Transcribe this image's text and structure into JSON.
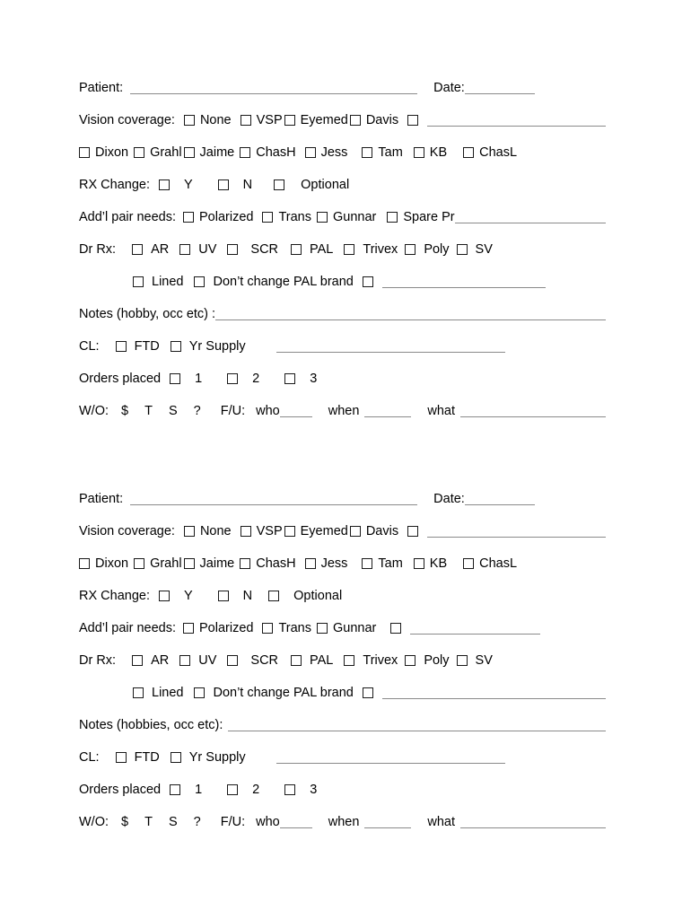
{
  "document": {
    "type": "optical-intake-form",
    "copies": 2,
    "ink_color": "#000000",
    "rule_color": "#8a8a8a"
  },
  "form1": {
    "patient": {
      "label": "Patient:"
    },
    "date": {
      "label": "Date:"
    },
    "vision_coverage": {
      "label": "Vision coverage:",
      "options": [
        "None",
        "VSP",
        "Eyemed",
        "Davis"
      ],
      "other_label": ""
    },
    "providers": [
      "Dixon",
      "Grahl",
      "Jaime",
      "ChasH",
      "Jess",
      "Tam",
      "KB",
      "ChasL"
    ],
    "rx_change": {
      "label": "RX Change:",
      "options": [
        "Y",
        "N",
        "Optional"
      ]
    },
    "addl_pair": {
      "label": "Add’l pair needs:",
      "options": [
        "Polarized",
        "Trans",
        "Gunnar"
      ],
      "spare_label": "Spare Pr"
    },
    "dr_rx": {
      "label": "Dr Rx:",
      "options": [
        "AR",
        "UV",
        "SCR",
        "PAL",
        "Trivex",
        "Poly",
        "SV"
      ]
    },
    "pal_row": {
      "lined": "Lined",
      "dont_change": "Don’t change PAL brand"
    },
    "notes": {
      "label": "Notes (hobby, occ etc) :"
    },
    "cl": {
      "label": "CL:",
      "options": [
        "FTD",
        "Yr Supply"
      ]
    },
    "orders_placed": {
      "label": "Orders placed",
      "options": [
        "1",
        "2",
        "3"
      ]
    },
    "wo": {
      "label": "W/O:",
      "marks": [
        "$",
        "T",
        "S",
        "?"
      ],
      "fu_label": "F/U:",
      "who": "who",
      "when": "when",
      "what": "what"
    }
  },
  "form2": {
    "patient": {
      "label": "Patient:"
    },
    "date": {
      "label": "Date:"
    },
    "vision_coverage": {
      "label": "Vision coverage:",
      "options": [
        "None",
        "VSP",
        "Eyemed",
        "Davis"
      ],
      "other_label": ""
    },
    "providers": [
      "Dixon",
      "Grahl",
      "Jaime",
      "ChasH",
      "Jess",
      "Tam",
      "KB",
      "ChasL"
    ],
    "rx_change": {
      "label": "RX Change:",
      "options": [
        "Y",
        "N",
        "Optional"
      ]
    },
    "addl_pair": {
      "label": "Add’l pair needs:",
      "options": [
        "Polarized",
        "Trans",
        "Gunnar"
      ],
      "spare_label": ""
    },
    "dr_rx": {
      "label": "Dr Rx:",
      "options": [
        "AR",
        "UV",
        "SCR",
        "PAL",
        "Trivex",
        "Poly",
        "SV"
      ]
    },
    "pal_row": {
      "lined": "Lined",
      "dont_change": "Don’t change PAL brand"
    },
    "notes": {
      "label": "Notes (hobbies, occ etc):"
    },
    "cl": {
      "label": "CL:",
      "options": [
        "FTD",
        "Yr Supply"
      ]
    },
    "orders_placed": {
      "label": "Orders placed",
      "options": [
        "1",
        "2",
        "3"
      ]
    },
    "wo": {
      "label": "W/O:",
      "marks": [
        "$",
        "T",
        "S",
        "?"
      ],
      "fu_label": "F/U:",
      "who": "who",
      "when": "when",
      "what": "what"
    }
  }
}
